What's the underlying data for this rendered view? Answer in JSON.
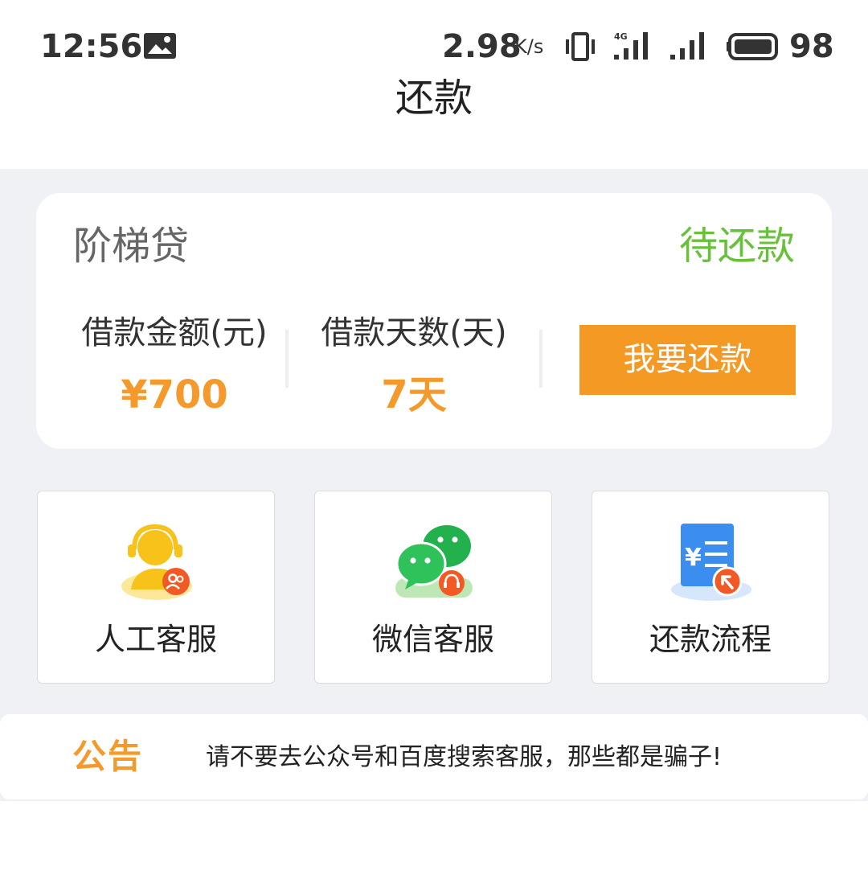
{
  "status_bar": {
    "time": "12:56",
    "network_speed": "2.98",
    "network_speed_unit": "K/s",
    "signal_type": "4G",
    "battery_level": "98"
  },
  "header": {
    "title": "还款"
  },
  "loan_card": {
    "product_name": "阶梯贷",
    "status": "待还款",
    "amount_label": "借款金额(元)",
    "amount_value": "¥700",
    "days_label": "借款天数(天)",
    "days_value": "7天",
    "repay_button_label": "我要还款"
  },
  "services": [
    {
      "label": "人工客服",
      "icon": "customer-service-icon"
    },
    {
      "label": "微信客服",
      "icon": "wechat-icon"
    },
    {
      "label": "还款流程",
      "icon": "repayment-process-icon"
    }
  ],
  "notice": {
    "tag": "公告",
    "text": "请不要去公众号和百度搜索客服，那些都是骗子!"
  },
  "colors": {
    "accent_orange": "#f49a24",
    "status_green": "#67c23a",
    "page_gray": "#eff1f4"
  }
}
